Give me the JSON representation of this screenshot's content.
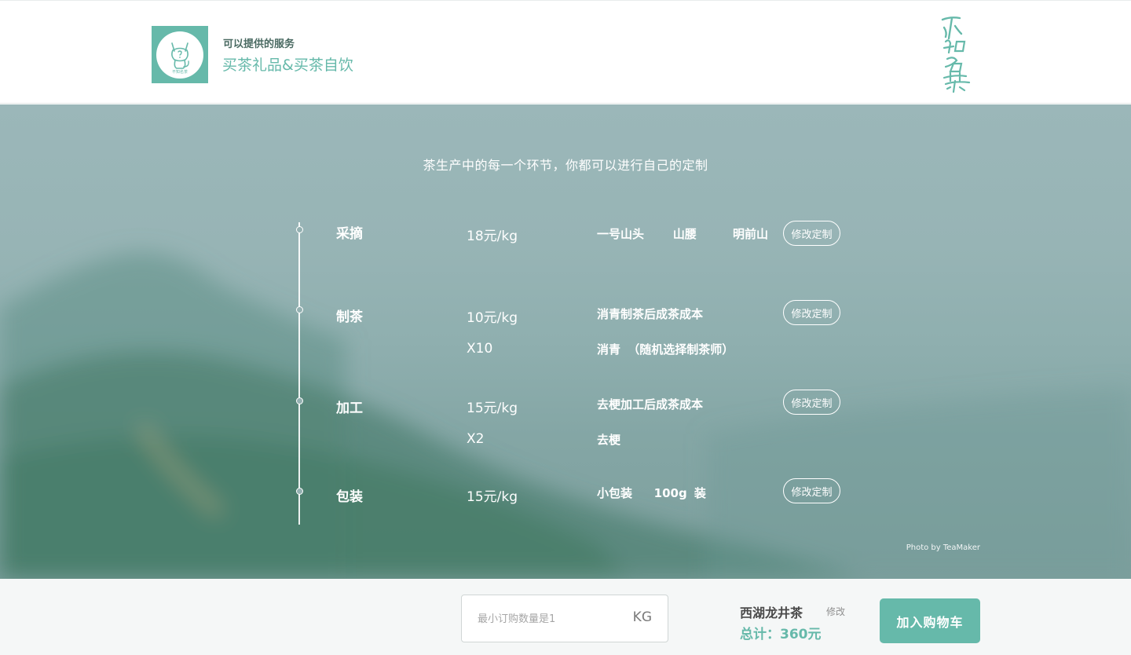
{
  "header": {
    "service_label": "可以提供的服务",
    "service_name": "买茶礼品&买茶自饮",
    "logo_text": "不知名茶",
    "brand_text": "不知名茶"
  },
  "hero": {
    "title": "茶生产中的每一个环节，你都可以进行自己的定制",
    "photo_credit": "Photo by TeaMaker",
    "steps": [
      {
        "stage": "采摘",
        "price": "18元/kg",
        "detail": "一号山头    山腰     明前山",
        "edit_label": "修改定制"
      },
      {
        "stage": "制茶",
        "price": "10元/kg",
        "detail": "消青制茶后成茶成本",
        "sub_price": "X10",
        "sub_detail": "消青 （随机选择制茶师）",
        "edit_label": "修改定制"
      },
      {
        "stage": "加工",
        "price": "15元/kg",
        "detail": "去梗加工后成茶成本",
        "sub_price": "X2",
        "sub_detail": "去梗",
        "edit_label": "修改定制"
      },
      {
        "stage": "包装",
        "price": "15元/kg",
        "detail": "小包装   100g 装",
        "edit_label": "修改定制"
      }
    ]
  },
  "footer": {
    "quantity_placeholder": "最小订购数量是1",
    "quantity_value": "",
    "unit": "KG",
    "product_name": "西湖龙井茶",
    "modify_label": "修改",
    "total_label": "总计：360元",
    "cart_button": "加入购物车"
  },
  "colors": {
    "accent": "#66b9aa",
    "hero_tint": "#94b0b1",
    "text_dark": "#4a4a4a"
  },
  "icons": {
    "logo": "cat-icon",
    "timeline_node": "timeline-dot-icon"
  }
}
